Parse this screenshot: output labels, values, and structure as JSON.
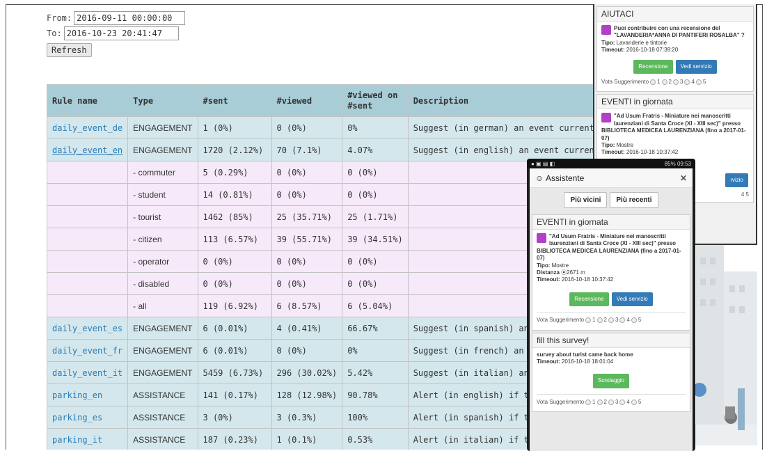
{
  "filters": {
    "from_label": "From:",
    "from_value": "2016-09-11 00:00:00",
    "to_label": "To:",
    "to_value": "2016-10-23 20:41:47",
    "refresh_label": "Refresh"
  },
  "table": {
    "headers": [
      "Rule name",
      "Type",
      "#sent",
      "#viewed",
      "#viewed on #sent",
      "Description"
    ],
    "rows": [
      {
        "name": "daily_event_de",
        "type": "ENGAGEMENT",
        "sent": "1 (0%)",
        "viewed": "0 (0%)",
        "ratio": "0%",
        "desc": "Suggest (in german) an event currently on in Floren"
      },
      {
        "name": "daily_event_en",
        "type": "ENGAGEMENT",
        "sent": "1720 (2.12%)",
        "viewed": "70 (7.1%)",
        "ratio": "4.07%",
        "desc": "Suggest (in english) an event currently on in Floren"
      },
      {
        "name": "",
        "type": "- commuter",
        "sent": "5 (0.29%)",
        "viewed": "0 (0%)",
        "ratio": "0 (0%)",
        "desc": ""
      },
      {
        "name": "",
        "type": "- student",
        "sent": "14 (0.81%)",
        "viewed": "0 (0%)",
        "ratio": "0 (0%)",
        "desc": ""
      },
      {
        "name": "",
        "type": "- tourist",
        "sent": "1462 (85%)",
        "viewed": "25 (35.71%)",
        "ratio": "25 (1.71%)",
        "desc": ""
      },
      {
        "name": "",
        "type": "- citizen",
        "sent": "113 (6.57%)",
        "viewed": "39 (55.71%)",
        "ratio": "39 (34.51%)",
        "desc": ""
      },
      {
        "name": "",
        "type": "- operator",
        "sent": "0 (0%)",
        "viewed": "0 (0%)",
        "ratio": "0 (0%)",
        "desc": ""
      },
      {
        "name": "",
        "type": "- disabled",
        "sent": "0 (0%)",
        "viewed": "0 (0%)",
        "ratio": "0 (0%)",
        "desc": ""
      },
      {
        "name": "",
        "type": "- all",
        "sent": "119 (6.92%)",
        "viewed": "6 (8.57%)",
        "ratio": "6 (5.04%)",
        "desc": ""
      },
      {
        "name": "daily_event_es",
        "type": "ENGAGEMENT",
        "sent": "6 (0.01%)",
        "viewed": "4 (0.41%)",
        "ratio": "66.67%",
        "desc": "Suggest (in spanish) an event curr"
      },
      {
        "name": "daily_event_fr",
        "type": "ENGAGEMENT",
        "sent": "6 (0.01%)",
        "viewed": "0 (0%)",
        "ratio": "0%",
        "desc": "Suggest (in french) an event curre"
      },
      {
        "name": "daily_event_it",
        "type": "ENGAGEMENT",
        "sent": "5459 (6.73%)",
        "viewed": "296 (30.02%)",
        "ratio": "5.42%",
        "desc": "Suggest (in italian) an event curre"
      },
      {
        "name": "parking_en",
        "type": "ASSISTANCE",
        "sent": "141 (0.17%)",
        "viewed": "128 (12.98%)",
        "ratio": "90.78%",
        "desc": "Alert (in english) if the user parked"
      },
      {
        "name": "parking_es",
        "type": "ASSISTANCE",
        "sent": "3 (0%)",
        "viewed": "3 (0.3%)",
        "ratio": "100%",
        "desc": "Alert (in spanish) if the user parke"
      },
      {
        "name": "parking_it",
        "type": "ASSISTANCE",
        "sent": "187 (0.23%)",
        "viewed": "1 (0.1%)",
        "ratio": "0.53%",
        "desc": "Alert (in italian) if the user parked"
      }
    ]
  },
  "widget": {
    "aiutaci_title": "AIUTACI",
    "aiutaci_text": "Puoi contribuire con una recensione del \"LAVANDERIA*ANNA DI PANTIFERI ROSALBA\" ?",
    "aiutaci_tipo_label": "Tipo:",
    "aiutaci_tipo": "Lavanderie e tintorie",
    "aiutaci_timeout_label": "Timeout:",
    "aiutaci_timeout": "2016-10-18 07:39:20",
    "recensione": "Recensione",
    "vedi_servizio": "Vedi servizio",
    "vota": "Vota Suggerimento",
    "eventi_title": "EVENTI in giornata",
    "eventi_text": "\"Ad Usum Fratris - Miniature nei manoscritti laurenziani di Santa Croce (XI - XIII sec)\" presso BIBLIOTECA MEDICEA LAURENZIANA (fino a 2017-01-07)",
    "eventi_tipo": "Mostre",
    "eventi_timeout": "2016-10-18 10:37:42",
    "partial_servizio": "rvizio",
    "partial_vote": "4 5"
  },
  "phone": {
    "status_right": "85% 09:53",
    "app_title": "Assistente",
    "close": "✕",
    "tab1": "Più vicini",
    "tab2": "Più recenti",
    "eventi_title": "EVENTI in giornata",
    "eventi_text": "\"Ad Usum Fratris - Miniature nei manoscritti laurenziani di Santa Croce (XI - XIII sec)\" presso BIBLIOTECA MEDICEA LAURENZIANA (fino a 2017-01-07)",
    "tipo_label": "Tipo:",
    "tipo": "Mostre",
    "distanza_label": "Distanza",
    "distanza": "2671 m",
    "timeout_label": "Timeout:",
    "timeout": "2016-10-18 10:37:42",
    "recensione": "Recensione",
    "vedi_servizio": "Vedi servizio",
    "vota": "Vota Suggerimento",
    "survey_title": "fill this survey!",
    "survey_text": "survey about turist came back home",
    "survey_timeout": "2016-10-18 18:01:04",
    "sondaggio": "Sondaggio"
  },
  "colors": {
    "header_bg": "#a9cdd6",
    "rule_row_bg": "#d4e7ec",
    "sub_row_bg": "#f6e9f9",
    "link": "#2a7bb5",
    "btn_green": "#5cb85c",
    "btn_blue": "#337ab7",
    "poi_purple": "#b140c6"
  }
}
